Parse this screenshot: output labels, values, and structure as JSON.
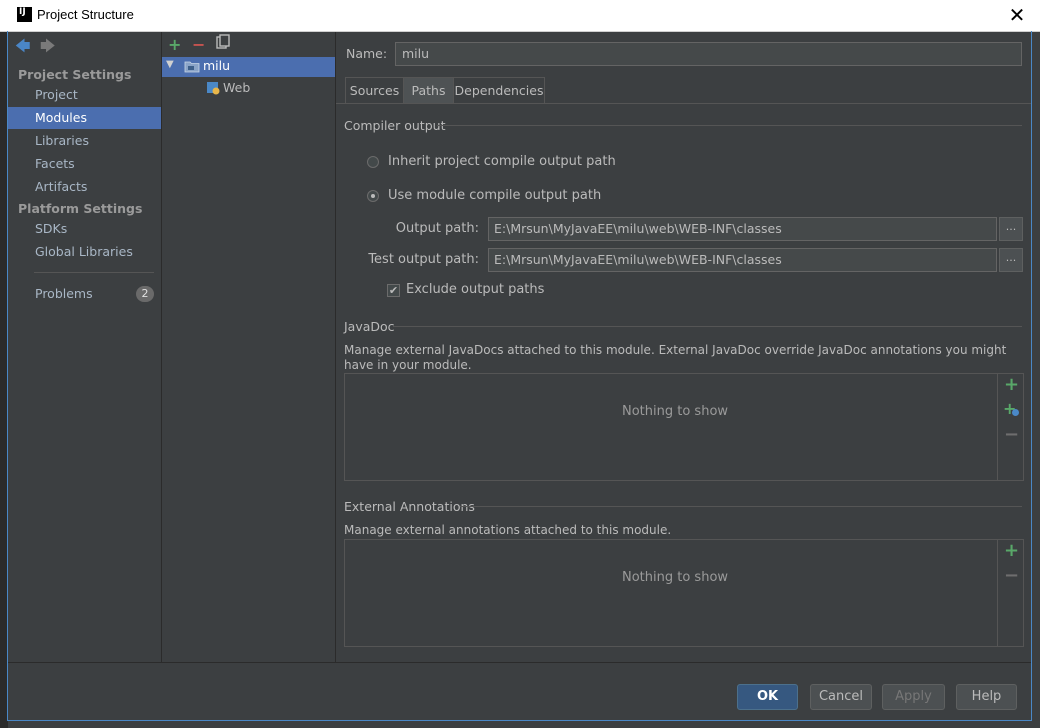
{
  "window": {
    "title": "Project Structure",
    "logo": "IJ"
  },
  "toolbar": {
    "back_icon": "arrow-left-icon",
    "forward_icon": "arrow-right-icon"
  },
  "nav": {
    "project_settings_header": "Project Settings",
    "project_settings": [
      "Project",
      "Modules",
      "Libraries",
      "Facets",
      "Artifacts"
    ],
    "platform_settings_header": "Platform Settings",
    "platform_settings": [
      "SDKs",
      "Global Libraries"
    ],
    "problems_label": "Problems",
    "problems_count": "2",
    "selected": "Modules"
  },
  "tree": {
    "module_name": "milu",
    "child": "Web"
  },
  "details": {
    "name_label": "Name:",
    "name_value": "milu",
    "tabs": [
      "Sources",
      "Paths",
      "Dependencies"
    ],
    "active_tab": "Paths",
    "compiler_output_title": "Compiler output",
    "inherit_label": "Inherit project compile output path",
    "use_module_label": "Use module compile output path",
    "output_path_label": "Output path:",
    "output_path_value": "E:\\Mrsun\\MyJavaEE\\milu\\web\\WEB-INF\\classes",
    "test_output_label": "Test output path:",
    "test_output_value": "E:\\Mrsun\\MyJavaEE\\milu\\web\\WEB-INF\\classes",
    "exclude_label": "Exclude output paths",
    "exclude_checked": true,
    "browse_label": "...",
    "javadoc_title": "JavaDoc",
    "javadoc_desc": "Manage external JavaDocs attached to this module. External JavaDoc override JavaDoc annotations you might have in your module.",
    "javadoc_empty": "Nothing to show",
    "annotations_title": "External Annotations",
    "annotations_desc": "Manage external annotations attached to this module.",
    "annotations_empty": "Nothing to show"
  },
  "buttons": {
    "ok": "OK",
    "cancel": "Cancel",
    "apply": "Apply",
    "help": "Help"
  },
  "colors": {
    "selection": "#4b6eaf",
    "accent": "#59a869",
    "background": "#3c3f41",
    "primary_button": "#365880"
  }
}
